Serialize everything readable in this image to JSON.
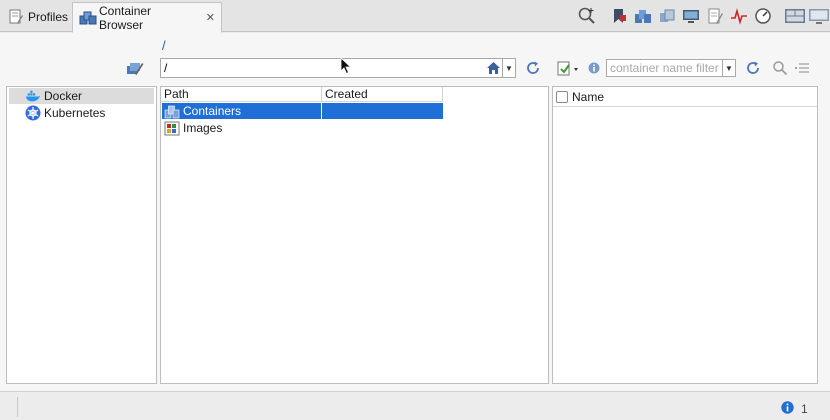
{
  "tabs": [
    {
      "label": "Profiles",
      "active": false,
      "icon": "profiles-icon"
    },
    {
      "label": "Container Browser",
      "active": true,
      "icon": "container-browser-icon",
      "close": "close-icon"
    }
  ],
  "toolbar_icons": [
    "search-plus-icon",
    "bookmark-icon",
    "containers-icon",
    "images-icon",
    "monitor-icon",
    "document-edit-icon",
    "activity-icon",
    "gauge-icon",
    "layout-icon",
    "display-icon"
  ],
  "breadcrumb": "/",
  "path": {
    "value": "/"
  },
  "filter": {
    "placeholder": "container name filter",
    "value": ""
  },
  "connections": [
    {
      "label": "Docker",
      "selected": true,
      "icon": "docker-icon"
    },
    {
      "label": "Kubernetes",
      "selected": false,
      "icon": "kubernetes-icon"
    }
  ],
  "table": {
    "columns": [
      "Path",
      "Created"
    ],
    "rows": [
      {
        "path": "Containers",
        "created": "",
        "selected": true,
        "icon": "containers-icon"
      },
      {
        "path": "Images",
        "created": "",
        "selected": false,
        "icon": "images-icon"
      }
    ]
  },
  "right_panel": {
    "header": "Name"
  },
  "status": {
    "count": "1"
  },
  "colors": {
    "selection": "#1f6fd6",
    "link": "#1b5fb8",
    "accent_red": "#c62828"
  }
}
